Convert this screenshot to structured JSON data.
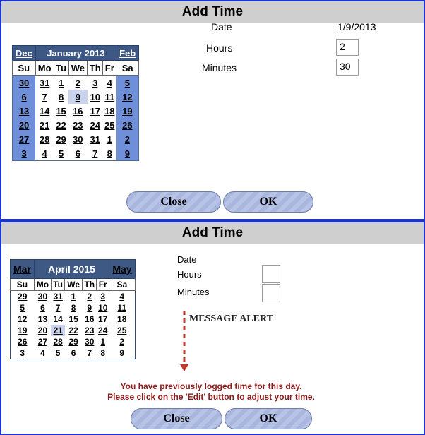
{
  "panel1": {
    "title": "Add Time",
    "calendar": {
      "prev": "Dec",
      "month": "January 2013",
      "next": "Feb",
      "dow": [
        "Su",
        "Mo",
        "Tu",
        "We",
        "Th",
        "Fr",
        "Sa"
      ],
      "weeks": [
        [
          "30",
          "31",
          "1",
          "2",
          "3",
          "4",
          "5"
        ],
        [
          "6",
          "7",
          "8",
          "9",
          "10",
          "11",
          "12"
        ],
        [
          "13",
          "14",
          "15",
          "16",
          "17",
          "18",
          "19"
        ],
        [
          "20",
          "21",
          "22",
          "23",
          "24",
          "25",
          "26"
        ],
        [
          "27",
          "28",
          "29",
          "30",
          "31",
          "1",
          "2"
        ],
        [
          "3",
          "4",
          "5",
          "6",
          "7",
          "8",
          "9"
        ]
      ],
      "selected": "9"
    },
    "form": {
      "date_label": "Date",
      "date_value": "1/9/2013",
      "hours_label": "Hours",
      "hours_value": "2",
      "minutes_label": "Minutes",
      "minutes_value": "30"
    },
    "buttons": {
      "close": "Close",
      "ok": "OK"
    }
  },
  "panel2": {
    "title": "Add Time",
    "calendar": {
      "prev": "Mar",
      "month": "April 2015",
      "next": "May",
      "dow": [
        "Su",
        "Mo",
        "Tu",
        "We",
        "Th",
        "Fr",
        "Sa"
      ],
      "weeks": [
        [
          "29",
          "30",
          "31",
          "1",
          "2",
          "3",
          "4"
        ],
        [
          "5",
          "6",
          "7",
          "8",
          "9",
          "10",
          "11"
        ],
        [
          "12",
          "13",
          "14",
          "15",
          "16",
          "17",
          "18"
        ],
        [
          "19",
          "20",
          "21",
          "22",
          "23",
          "24",
          "25"
        ],
        [
          "26",
          "27",
          "28",
          "29",
          "30",
          "1",
          "2"
        ],
        [
          "3",
          "4",
          "5",
          "6",
          "7",
          "8",
          "9"
        ]
      ],
      "selected": "21"
    },
    "form": {
      "date_label": "Date",
      "date_value": "",
      "hours_label": "Hours",
      "hours_value": "",
      "minutes_label": "Minutes",
      "minutes_value": ""
    },
    "annotation": "MESSAGE ALERT",
    "message_line1": "You have previously logged time for this day.",
    "message_line2": "Please click on the 'Edit' button to adjust your time.",
    "buttons": {
      "close": "Close",
      "ok": "OK"
    }
  },
  "colors": {
    "border": "#1d35c8",
    "header_bg": "#cfcfcf",
    "cal_header": "#3d5885",
    "weekend": "#6f8fd9",
    "message": "#8e1b1b",
    "arrow": "#c0392b"
  }
}
